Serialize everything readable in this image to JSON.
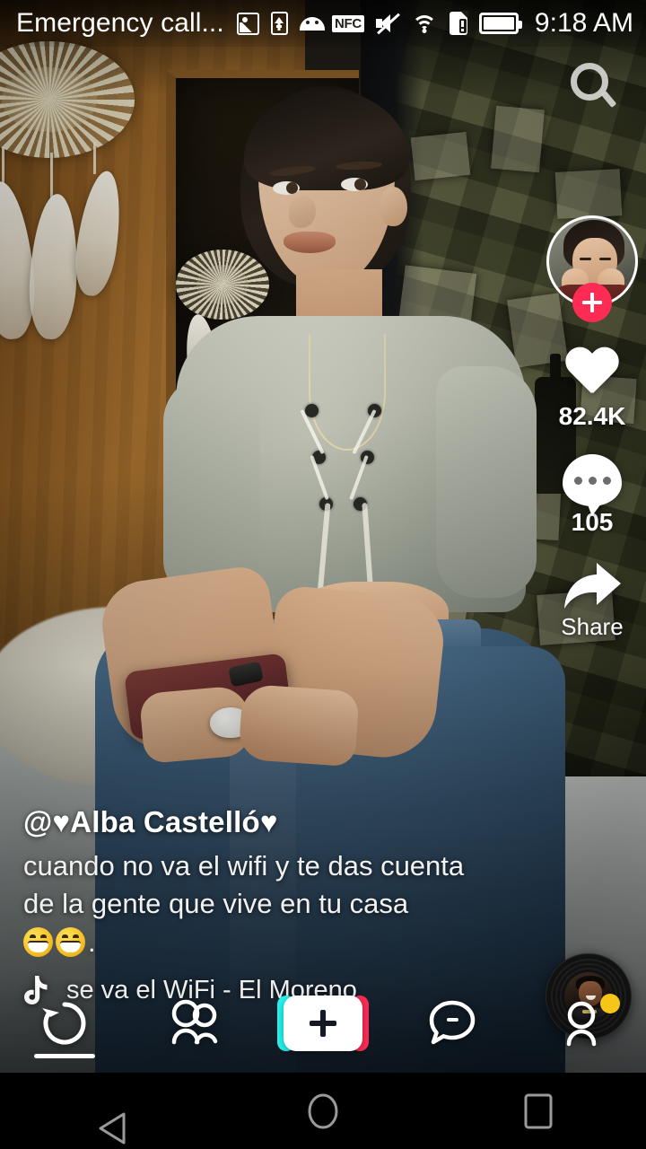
{
  "status_bar": {
    "notification_title": "Emergency call...",
    "left_icons": [
      "image-icon",
      "sd-card-upload-icon",
      "android-robot-icon"
    ],
    "right_icons": [
      "nfc-icon",
      "volume-muted-icon",
      "wifi-icon",
      "sim-card-alert-icon",
      "battery-full-icon"
    ],
    "clock": "9:18 AM"
  },
  "action_rail": {
    "search_icon": "search-icon",
    "avatar": {
      "follow_badge": "plus-icon",
      "accent_color": "#fe2c55"
    },
    "like": {
      "icon": "heart-icon",
      "count": "82.4K"
    },
    "comment": {
      "icon": "comment-bubble-icon",
      "count": "105"
    },
    "share": {
      "icon": "share-arrow-icon",
      "label": "Share"
    },
    "music_disc": "vinyl-record-icon"
  },
  "caption": {
    "username": "@♥Alba Castelló♥",
    "line1": "cuando no va el wifi y te das cuenta",
    "line2": "de la gente que vive en tu casa",
    "line3_suffix": ".",
    "emoji_count": 2,
    "music_icon": "tiktok-note-icon",
    "music_title": "se va el WiFi - El Moreno"
  },
  "bottom_nav": {
    "items": [
      {
        "name": "home",
        "icon": "replay-circular-arrow-icon",
        "active": true
      },
      {
        "name": "friends",
        "icon": "two-people-icon",
        "active": false
      },
      {
        "name": "create",
        "icon": "plus-icon",
        "active": false
      },
      {
        "name": "inbox",
        "icon": "message-bubble-icon",
        "active": false
      },
      {
        "name": "profile",
        "icon": "person-icon",
        "active": false,
        "badge_color": "#f5c518"
      }
    ]
  },
  "system_nav": {
    "back": "back-triangle-icon",
    "home": "home-circle-icon",
    "recents": "recents-square-icon"
  },
  "colors": {
    "tiktok_red": "#fe2c55",
    "tiktok_cyan": "#25f4ee",
    "badge_yellow": "#f5c518"
  }
}
